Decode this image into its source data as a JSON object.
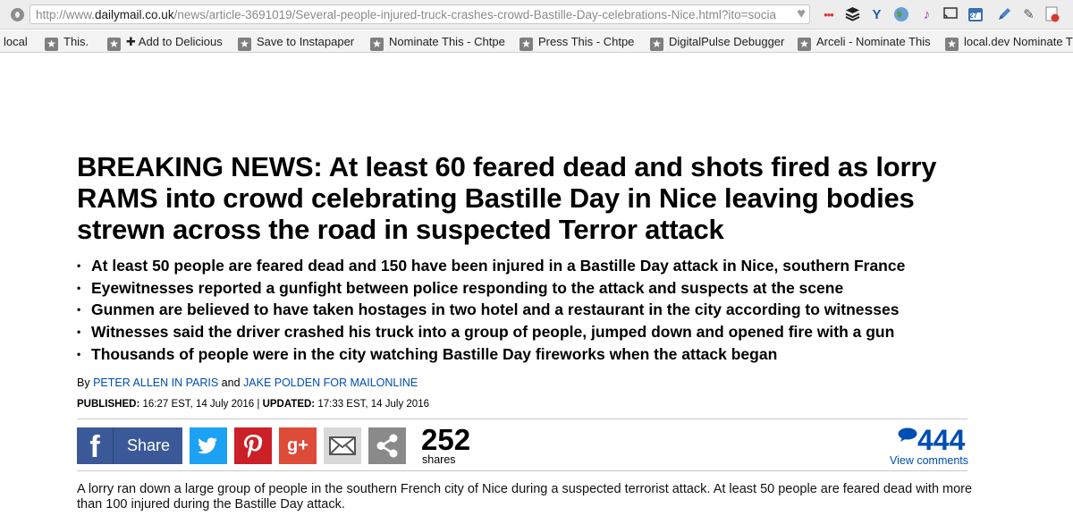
{
  "browser": {
    "url_prefix": "http://www.",
    "url_domain": "dailymail.co.uk",
    "url_path": "/news/article-3691019/Several-people-injured-truck-crashes-crowd-Bastille-Day-celebrations-Nice.html?ito=socia",
    "extension_icons": [
      "heart-icon",
      "dots-icon",
      "buffer-icon",
      "y-icon",
      "globe-icon",
      "music-note-icon",
      "cast-icon",
      "calendar-icon",
      "pen-icon",
      "tools-icon",
      "pdf-icon"
    ],
    "calendar_badge": "27"
  },
  "bookmarks": [
    {
      "label": "local"
    },
    {
      "label": "This."
    },
    {
      "label": "✚ Add to Delicious"
    },
    {
      "label": "Save to Instapaper"
    },
    {
      "label": "Nominate This - Chtpe"
    },
    {
      "label": "Press This - Chtpe"
    },
    {
      "label": "DigitalPulse Debugger"
    },
    {
      "label": "Arceli - Nominate This"
    },
    {
      "label": "local.dev Nominate Th"
    }
  ],
  "article": {
    "headline": "BREAKING NEWS: At least 60 feared dead and shots fired as lorry RAMS into crowd celebrating Bastille Day in Nice leaving bodies strewn across the road in suspected Terror attack",
    "bullets": [
      "At least 50 people are feared dead and 150 have been injured in a Bastille Day attack in Nice, southern France",
      "Eyewitnesses reported a gunfight between police responding to the attack and suspects at the scene",
      "Gunmen are believed to have taken hostages in two hotel and a restaurant in the city according to witnesses",
      "Witnesses said the driver crashed his truck into a group of people, jumped down and opened fire with a gun",
      "Thousands of people were in the city watching Bastille Day fireworks when the attack began"
    ],
    "byline": {
      "by": "By",
      "author1": "PETER ALLEN IN PARIS",
      "and": "and",
      "author2": "JAKE POLDEN FOR MAILONLINE"
    },
    "published_label": "PUBLISHED:",
    "published_value": "16:27 EST, 14 July 2016",
    "separator": "|",
    "updated_label": "UPDATED:",
    "updated_value": "17:33 EST, 14 July 2016",
    "body": "A lorry ran down a large group of people in the southern French city of Nice during a suspected terrorist attack. At least 50 people are feared dead with more than 100 injured during the Bastille Day attack."
  },
  "share": {
    "facebook_label": "Share",
    "google_label": "g+",
    "count": "252",
    "count_label": "shares"
  },
  "comments": {
    "count": "444",
    "link_label": "View comments"
  },
  "colors": {
    "facebook": "#3b5998",
    "twitter": "#1da1f2",
    "pinterest": "#cb2027",
    "google": "#dd4b39",
    "link": "#004db3"
  }
}
